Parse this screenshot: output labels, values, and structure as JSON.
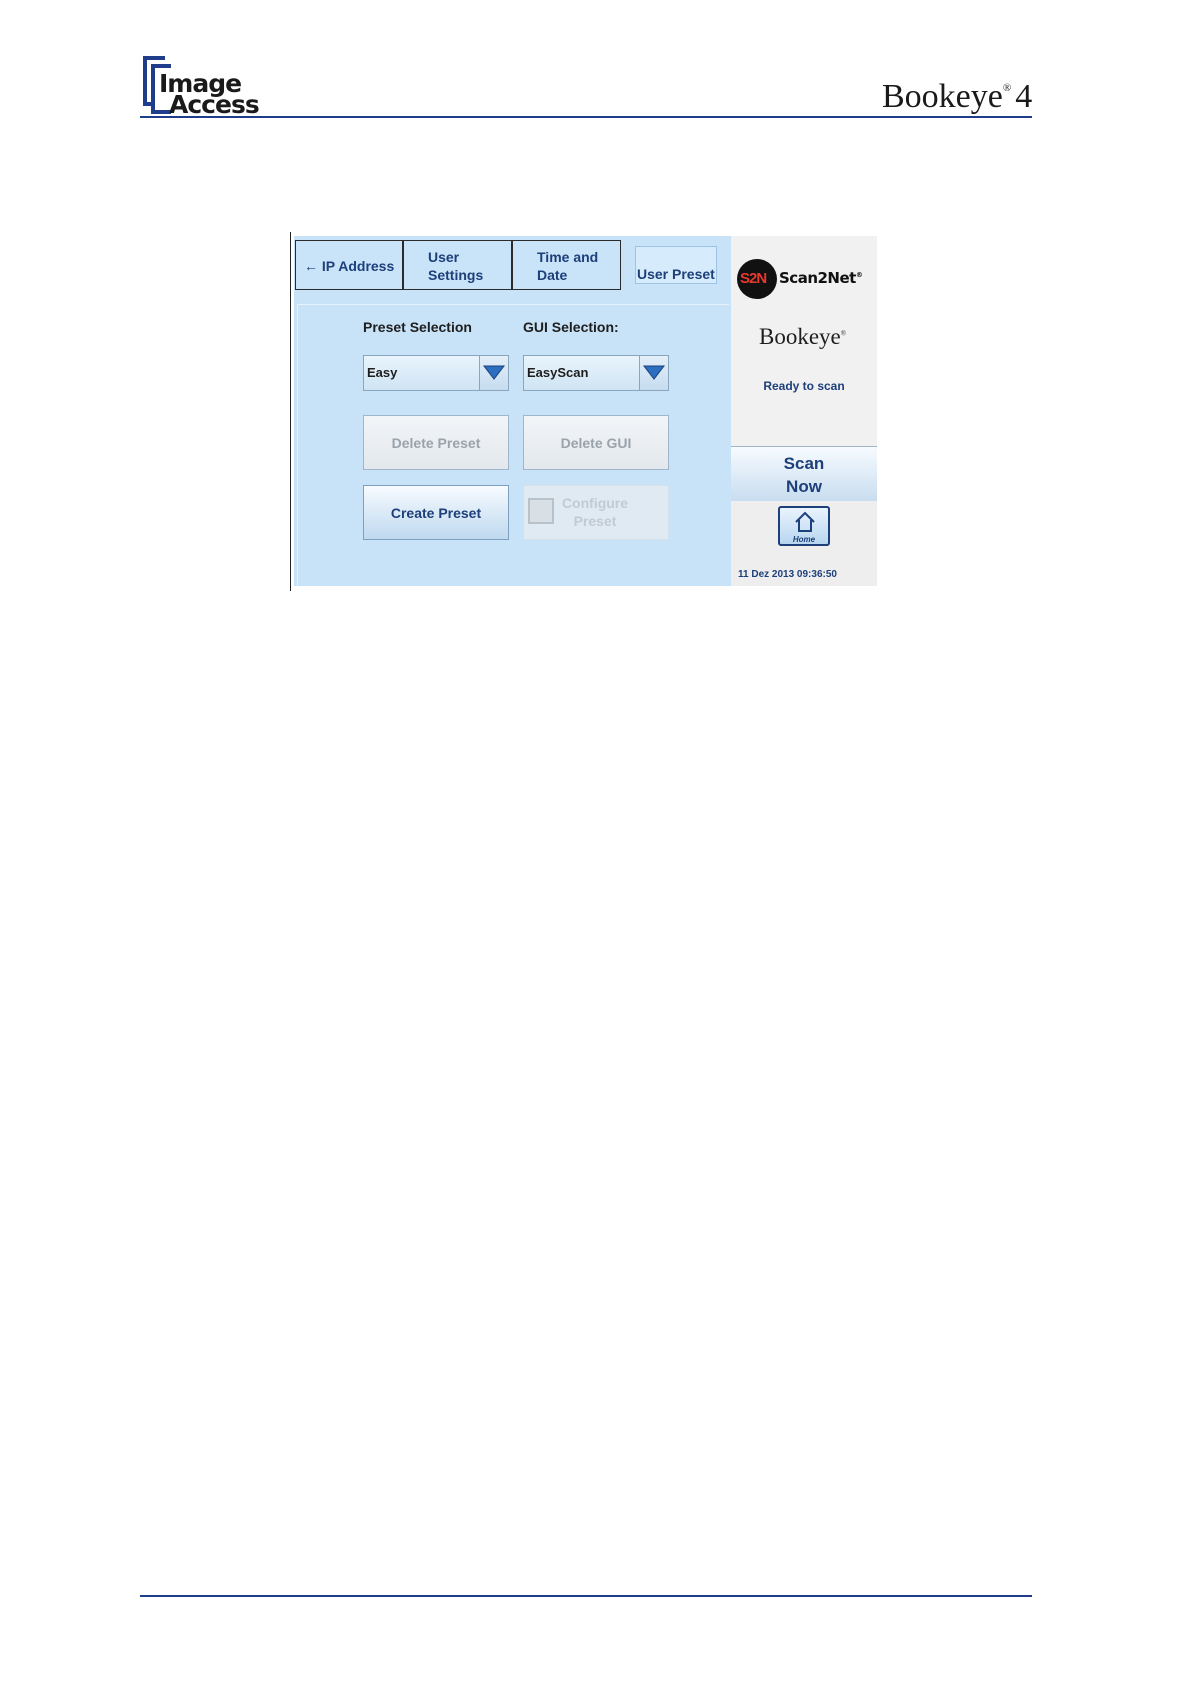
{
  "header": {
    "logo_left_line1": "Image",
    "logo_left_line2": "Access",
    "logo_right_name": "Bookeye",
    "logo_right_mark": "®",
    "logo_right_number": "4"
  },
  "tabs": [
    {
      "label": "← IP Address"
    },
    {
      "label": "User Settings"
    },
    {
      "label": "Time and Date"
    },
    {
      "label": "User Preset"
    }
  ],
  "preset_selection": {
    "label": "Preset Selection",
    "value": "Easy"
  },
  "gui_selection": {
    "label": "GUI Selection:",
    "value": "EasyScan"
  },
  "buttons": {
    "delete_preset": "Delete Preset",
    "delete_gui": "Delete GUI",
    "create_preset": "Create Preset",
    "configure_preset": "Configure Preset"
  },
  "sidebar": {
    "s2n_badge": "S2N",
    "s2n_word": "Scan2Net",
    "s2n_mark": "®",
    "brand": "Bookeye",
    "brand_mark": "®",
    "status": "Ready to scan",
    "scan_button": "Scan Now",
    "home_label": "Home",
    "datetime": "11 Dez 2013 09:36:50"
  },
  "colors": {
    "accent": "#1d3f7a",
    "panel_bg": "#c8e2f7",
    "rule": "#1f3d8a"
  }
}
